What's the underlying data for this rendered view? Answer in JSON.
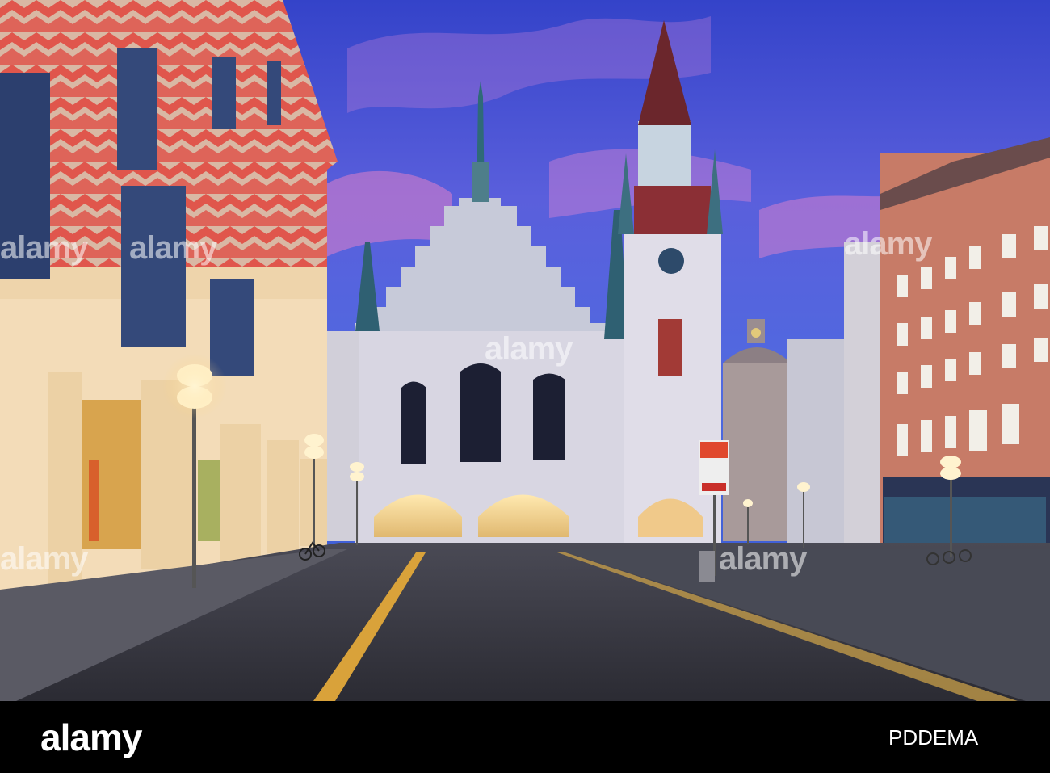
{
  "watermark": {
    "text": "alamy"
  },
  "footer": {
    "brand": "alamy",
    "image_id": "PDDEMA",
    "background": "#000000"
  },
  "scene": {
    "sky_top": "#3b4fd6",
    "sky_pink": "#d882d8",
    "road": "#3a3a44",
    "road_line": "#d9a23a",
    "building_left_pattern": "#e2574f",
    "building_right": "#c97a68",
    "tower_roof": "#7a2a2e"
  }
}
